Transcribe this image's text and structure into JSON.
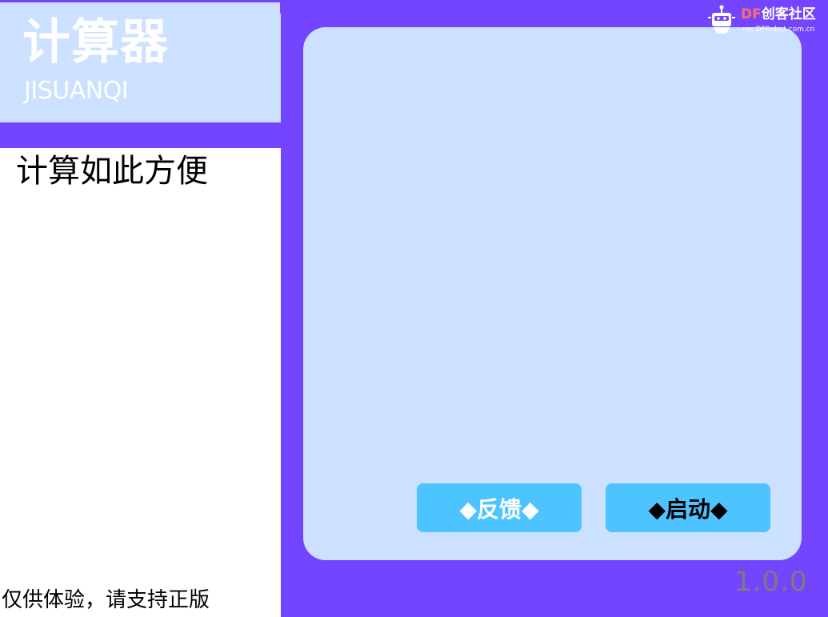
{
  "header": {
    "title": "计算器",
    "subtitle": "JISUANQI"
  },
  "left_panel": {
    "tagline": "计算如此方便",
    "disclaimer": "仅供体验，请支持正版"
  },
  "display": {
    "value": ""
  },
  "buttons": {
    "feedback_label": "◆反馈◆",
    "start_label": "◆启动◆"
  },
  "version": "1.0.0",
  "logo": {
    "brand_prefix": "DF",
    "brand_name": "创客社区",
    "url": "mc.DFRobot.com.cn",
    "icon": "robot-icon"
  },
  "colors": {
    "background": "#7445FF",
    "panel": "#CCE0FF",
    "button": "#4DC4FF",
    "version_text": "#7C7C7C"
  }
}
